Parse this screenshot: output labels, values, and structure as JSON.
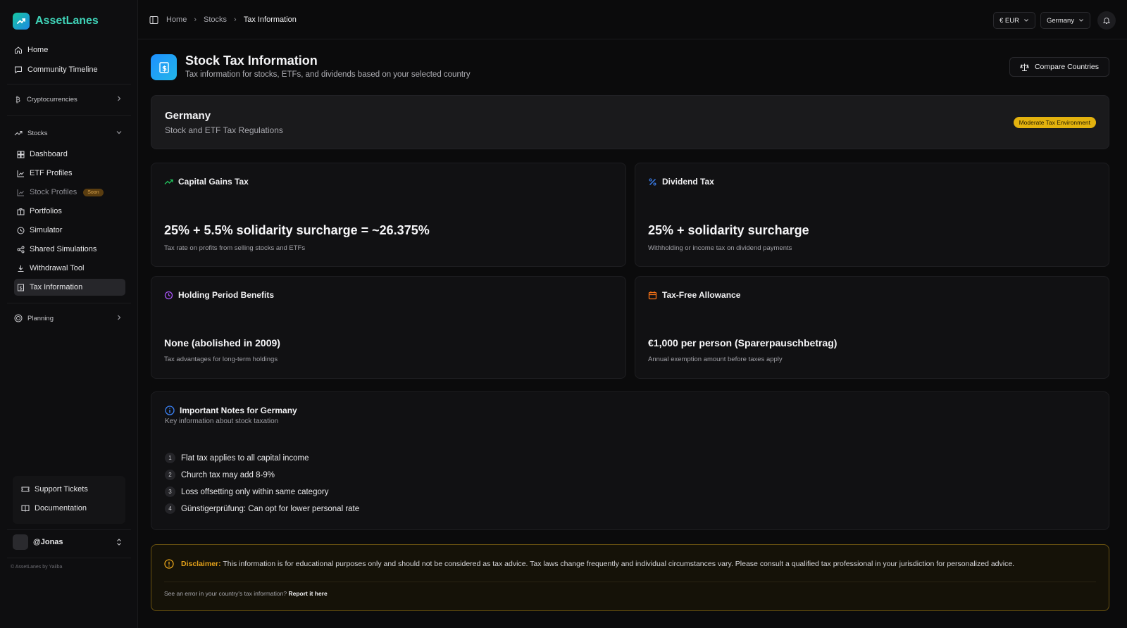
{
  "brand": {
    "name": "AssetLanes"
  },
  "sidebar": {
    "home": "Home",
    "community": "Community Timeline",
    "crypto": "Cryptocurrencies",
    "stocks": "Stocks",
    "stock_items": [
      {
        "label": "Dashboard"
      },
      {
        "label": "ETF Profiles"
      },
      {
        "label": "Stock Profiles",
        "badge": "Soon"
      },
      {
        "label": "Portfolios"
      },
      {
        "label": "Simulator"
      },
      {
        "label": "Shared Simulations"
      },
      {
        "label": "Withdrawal Tool"
      },
      {
        "label": "Tax Information"
      }
    ],
    "planning": "Planning",
    "support": "Support Tickets",
    "documentation": "Documentation",
    "user": "@Jonas",
    "footer": "© AssetLanes by Yaiiba"
  },
  "topbar": {
    "breadcrumb": [
      "Home",
      "Stocks",
      "Tax Information"
    ],
    "currency": "€ EUR",
    "country": "Germany"
  },
  "page": {
    "title": "Stock Tax Information",
    "subtitle": "Tax information for stocks, ETFs, and dividends based on your selected country",
    "compare_button": "Compare Countries"
  },
  "country_card": {
    "name": "Germany",
    "subtitle": "Stock and ETF Tax Regulations",
    "badge": "Moderate Tax Environment"
  },
  "tax_cards": {
    "capital_gains": {
      "title": "Capital Gains Tax",
      "value": "25% + 5.5% solidarity surcharge = ~26.375%",
      "desc": "Tax rate on profits from selling stocks and ETFs"
    },
    "dividend": {
      "title": "Dividend Tax",
      "value": "25% + solidarity surcharge",
      "desc": "Withholding or income tax on dividend payments"
    },
    "holding": {
      "title": "Holding Period Benefits",
      "value": "None (abolished in 2009)",
      "desc": "Tax advantages for long-term holdings"
    },
    "allowance": {
      "title": "Tax-Free Allowance",
      "value": "€1,000 per person (Sparerpauschbetrag)",
      "desc": "Annual exemption amount before taxes apply"
    }
  },
  "notes": {
    "title": "Important Notes for Germany",
    "subtitle": "Key information about stock taxation",
    "items": [
      {
        "num": "1",
        "text": "Flat tax applies to all capital income"
      },
      {
        "num": "2",
        "text": "Church tax may add 8-9%"
      },
      {
        "num": "3",
        "text": "Loss offsetting only within same category"
      },
      {
        "num": "4",
        "text": "Günstigerprüfung: Can opt for lower personal rate"
      }
    ]
  },
  "disclaimer": {
    "label": "Disclaimer:",
    "text": "This information is for educational purposes only and should not be considered as tax advice. Tax laws change frequently and individual circumstances vary. Please consult a qualified tax professional in your jurisdiction for personalized advice.",
    "report_prefix": "See an error in your country's tax information?",
    "report_link": "Report it here"
  },
  "colors": {
    "accent": "#3fd3b8",
    "badge": "#e3b20e",
    "disclaimer": "#e3a11a",
    "icon_blue": "#1e90ff"
  }
}
